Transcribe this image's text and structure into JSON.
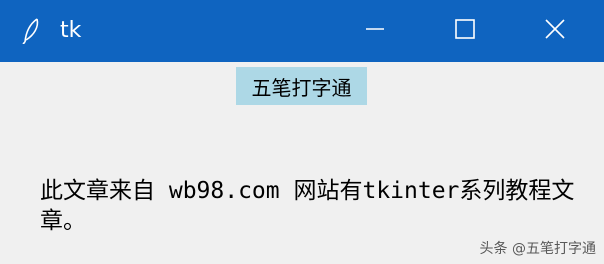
{
  "window": {
    "title": "tk",
    "titlebar_color": "#0f64c0",
    "icon": "feather-icon",
    "controls": {
      "minimize_icon": "minimize-icon",
      "maximize_icon": "maximize-icon",
      "close_icon": "close-icon"
    }
  },
  "content": {
    "label_text": "五笔打字通",
    "label_background": "#add8e6",
    "body_text": "此文章来自 wb98.com 网站有tkinter系列教程文章。"
  },
  "watermark": {
    "text": "头条 @五笔打字通"
  }
}
